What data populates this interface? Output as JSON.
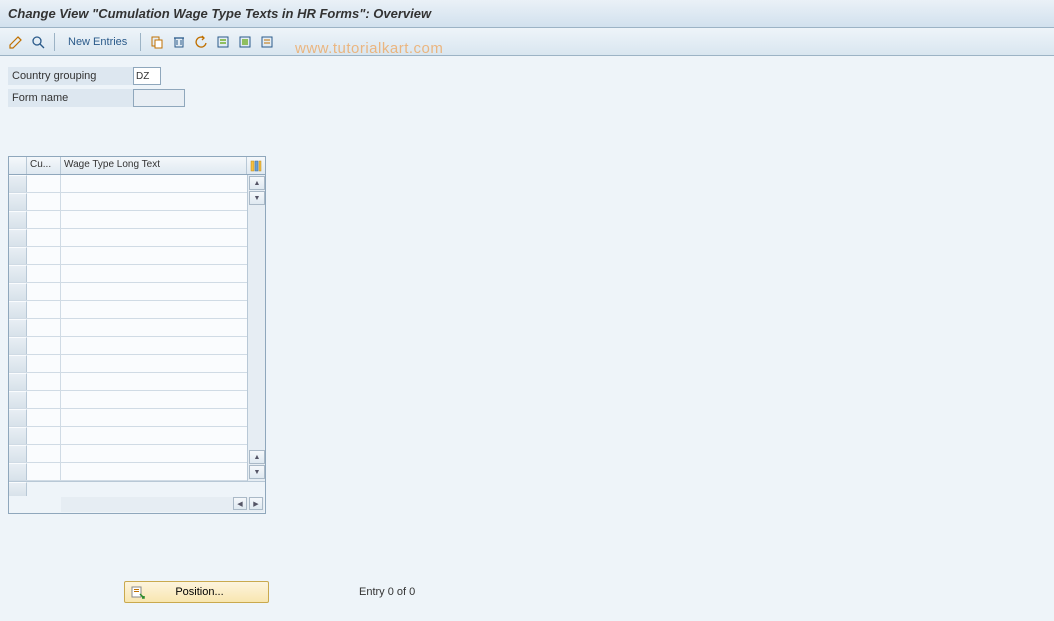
{
  "title": "Change View \"Cumulation Wage Type Texts in HR Forms\": Overview",
  "watermark": "www.tutorialkart.com",
  "toolbar": {
    "new_entries_label": "New Entries"
  },
  "fields": {
    "country_grouping_label": "Country grouping",
    "country_grouping_value": "DZ",
    "form_name_label": "Form name",
    "form_name_value": ""
  },
  "table": {
    "col1_header": "Cu...",
    "col2_header": "Wage Type Long Text",
    "row_count": 17
  },
  "footer": {
    "position_label": "Position...",
    "entry_text": "Entry 0 of 0"
  }
}
